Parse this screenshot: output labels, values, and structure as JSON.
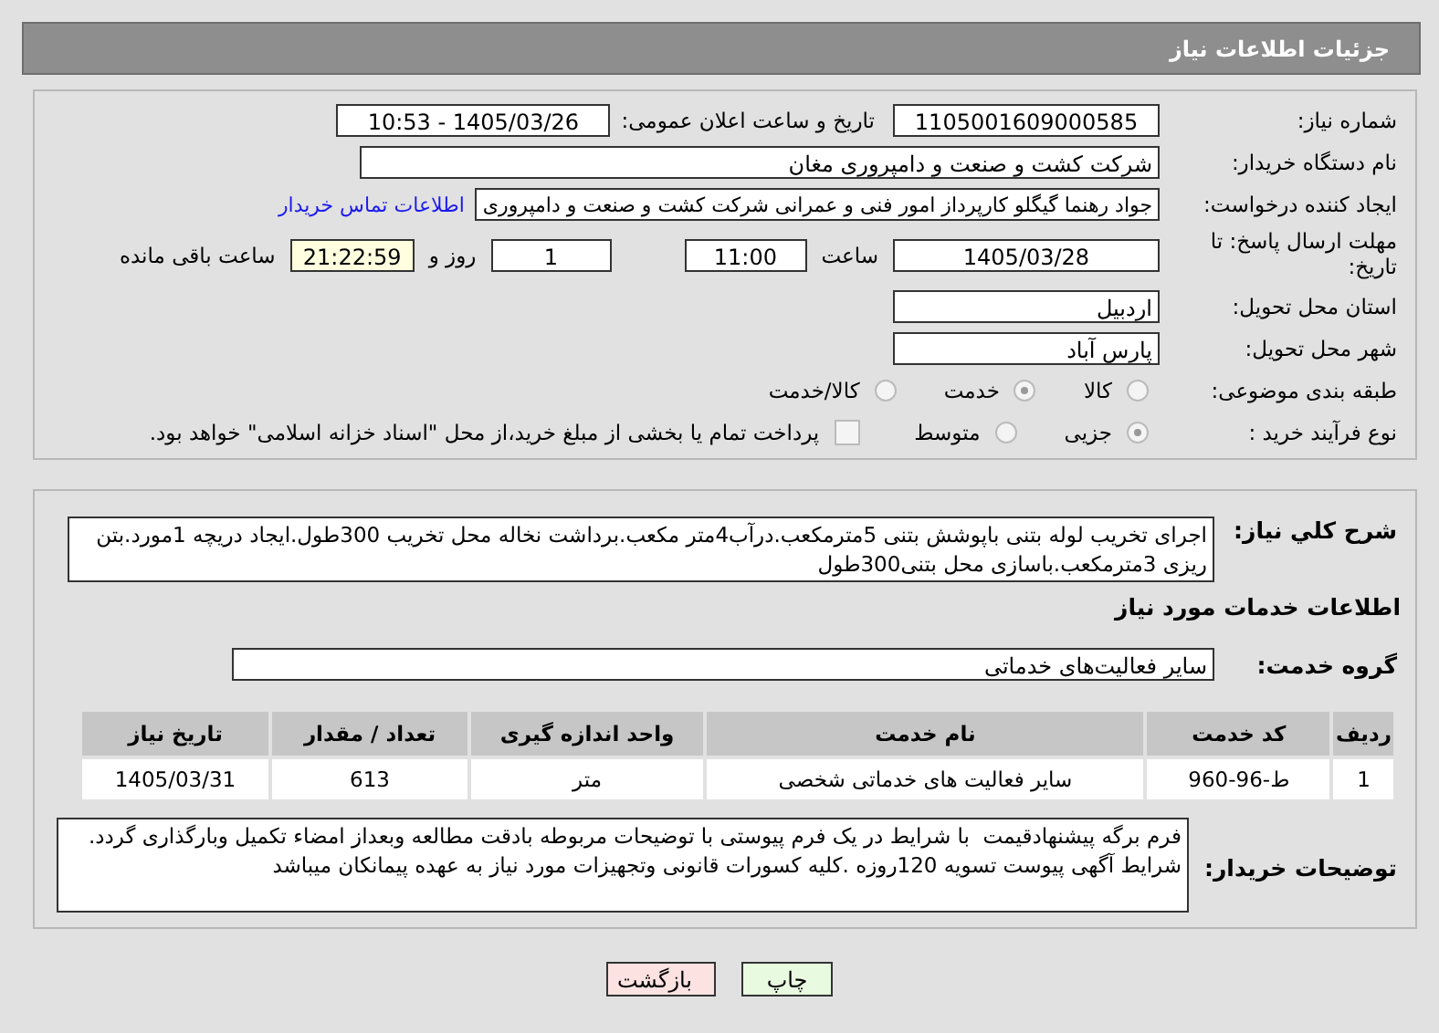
{
  "header": {
    "title": "جزئیات اطلاعات نیاز"
  },
  "need_number": {
    "label": "شماره نیاز:",
    "value": "1105001609000585"
  },
  "announce": {
    "label": "تاریخ و ساعت اعلان عمومی:",
    "value": "1405/03/26 - 10:53"
  },
  "buyer_org": {
    "label": "نام دستگاه خریدار:",
    "value": "شرکت کشت و صنعت و دامپروری مغان"
  },
  "creator": {
    "label": "ایجاد کننده درخواست:",
    "value": "جواد رهنما گیگلو کارپرداز امور فنی و عمرانی  شرکت کشت و صنعت و دامپروری",
    "link": "اطلاعات تماس خریدار"
  },
  "deadline": {
    "label": "مهلت ارسال پاسخ: تا تاریخ:",
    "date": "1405/03/28",
    "time_label": "ساعت",
    "time": "11:00",
    "days": "1",
    "days_label": "روز و",
    "remaining": "21:22:59",
    "remaining_label": "ساعت باقی مانده"
  },
  "province": {
    "label": "استان محل تحویل:",
    "value": "اردبیل"
  },
  "city": {
    "label": "شهر محل تحویل:",
    "value": "پارس آباد"
  },
  "category": {
    "label": "طبقه بندی موضوعی:",
    "options": [
      {
        "label": "کالا",
        "selected": false
      },
      {
        "label": "خدمت",
        "selected": true
      },
      {
        "label": "کالا/خدمت",
        "selected": false
      }
    ]
  },
  "purchase_type": {
    "label": "نوع فرآیند خرید :",
    "options": [
      {
        "label": "جزیی",
        "selected": true
      },
      {
        "label": "متوسط",
        "selected": false
      }
    ],
    "payment": {
      "label": "پرداخت تمام یا بخشی از مبلغ خرید،از محل \"اسناد خزانه اسلامی\" خواهد بود.",
      "checked": false
    }
  },
  "summary": {
    "label": "شرح کلي نياز:",
    "value": "اجرای تخریب لوله بتنی باپوشش بتنی 5مترمکعب.درآب4متر مکعب.برداشت نخاله محل تخریب 300طول.ایجاد دریچه 1مورد.بتن ریزی 3مترمکعب.باسازی محل بتنی300طول"
  },
  "services_heading": "اطلاعات خدمات مورد نياز",
  "service_group": {
    "label": "گروه خدمت:",
    "value": "سایر فعالیت‌های خدماتی"
  },
  "table": {
    "columns": [
      "ردیف",
      "کد خدمت",
      "نام خدمت",
      "واحد اندازه گیری",
      "تعداد / مقدار",
      "تاریخ نیاز"
    ],
    "rows": [
      [
        "1",
        "ط-96-960",
        "سایر فعالیت های خدماتی شخصی",
        "متر",
        "613",
        "1405/03/31"
      ]
    ]
  },
  "buyer_notes": {
    "label": "توضیحات خریدار:",
    "value": "فرم برگه پیشنهادقیمت  با شرایط در یک فرم پیوستی با توضیحات مربوطه بادقت مطالعه وبعداز امضاء تکمیل وبارگذاری گردد.\nشرایط آگهی پیوست تسویه 120روزه .کلیه کسورات قانونی وتجهیزات مورد نیاز به عهده پیمانکان میباشد"
  },
  "buttons": [
    {
      "kind": "print",
      "label": "چاپ"
    },
    {
      "kind": "back",
      "label": "بازگشت"
    }
  ]
}
